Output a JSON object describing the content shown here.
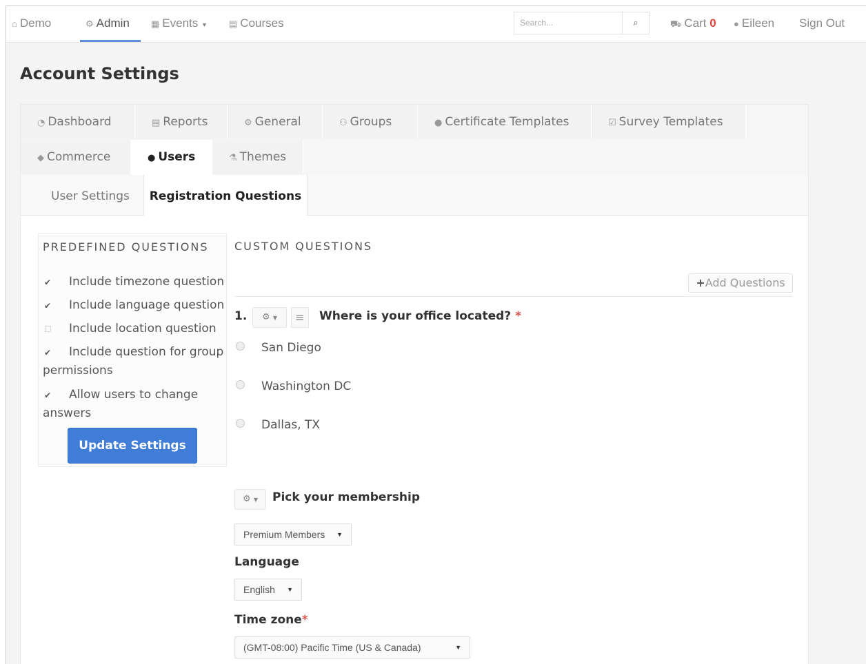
{
  "nav": {
    "demo": "Demo",
    "admin": "Admin",
    "events": "Events",
    "courses": "Courses",
    "search_placeholder": "Search...",
    "cart": "Cart",
    "cart_count": "0",
    "user": "Eileen",
    "signout": "Sign Out"
  },
  "page_title": "Account Settings",
  "tabs": [
    {
      "label": "Dashboard",
      "icon": "dashboard-icon"
    },
    {
      "label": "Reports",
      "icon": "reports-icon"
    },
    {
      "label": "General",
      "icon": "gear-icon"
    },
    {
      "label": "Groups",
      "icon": "groups-icon"
    },
    {
      "label": "Certificate Templates",
      "icon": "certificate-icon"
    },
    {
      "label": "Survey Templates",
      "icon": "survey-icon"
    },
    {
      "label": "Commerce",
      "icon": "tag-icon"
    },
    {
      "label": "Users",
      "icon": "user-icon",
      "active": true
    },
    {
      "label": "Themes",
      "icon": "flask-icon"
    }
  ],
  "subtabs": [
    {
      "label": "User Settings"
    },
    {
      "label": "Registration Questions",
      "active": true
    }
  ],
  "predefined": {
    "title": "PREDEFINED QUESTIONS",
    "items": [
      {
        "label": "Include timezone question",
        "checked": true
      },
      {
        "label": "Include language question",
        "checked": true
      },
      {
        "label": "Include location question",
        "checked": false
      },
      {
        "label": "Include question for group permissions",
        "checked": true
      },
      {
        "label": "Allow users to change answers",
        "checked": true
      }
    ],
    "update_button": "Update Settings"
  },
  "custom": {
    "title": "CUSTOM QUESTIONS",
    "add_button": "Add Questions",
    "q1": {
      "number": "1.",
      "text": "Where is your office located?",
      "required": "*",
      "options": [
        "San Diego",
        "Washington DC",
        "Dallas, TX"
      ]
    },
    "q2": {
      "text": "Pick your membership",
      "selected": "Premium Members"
    },
    "language": {
      "label": "Language",
      "selected": "English"
    },
    "timezone": {
      "label": "Time zone",
      "required": "*",
      "selected": "(GMT-08:00) Pacific Time (US & Canada)"
    }
  },
  "colors": {
    "primary_button": "#3f7dd8",
    "required": "#d9534f",
    "cart_count": "#e0423b",
    "nav_underline": "#5b8fd6"
  }
}
